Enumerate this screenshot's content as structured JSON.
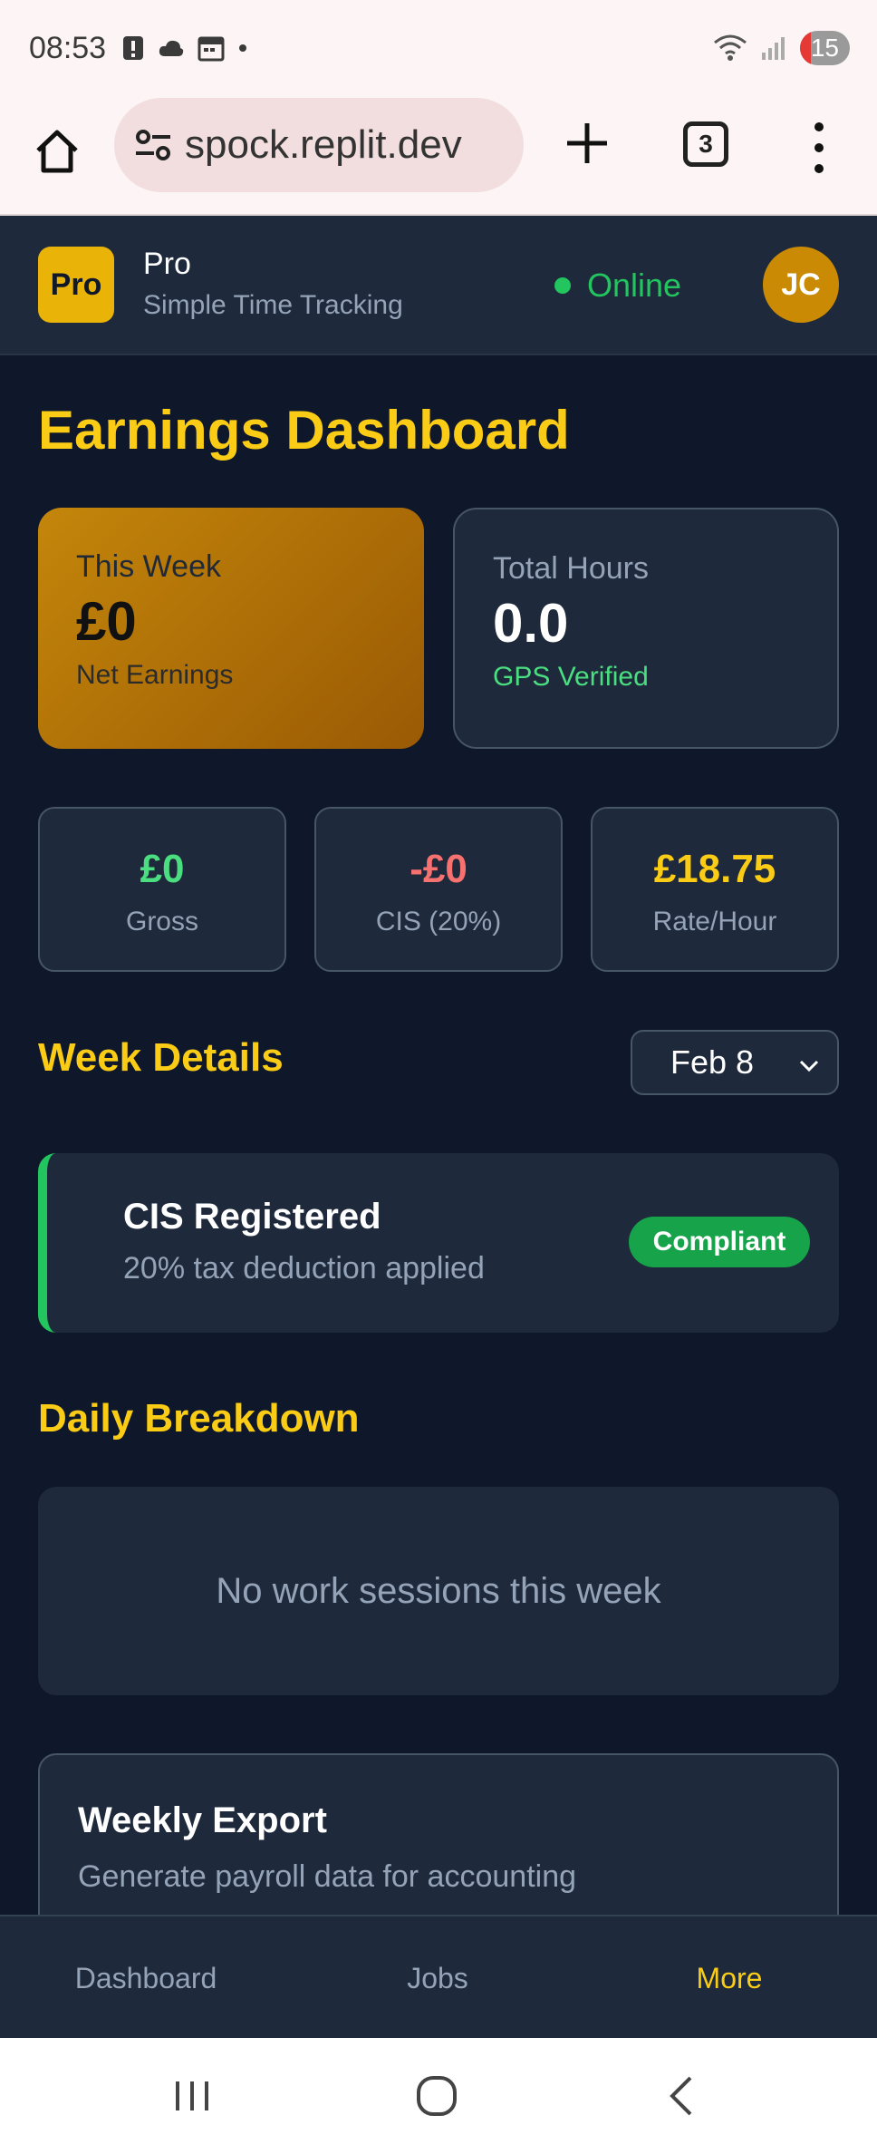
{
  "status_bar": {
    "time": "08:53",
    "battery": "15"
  },
  "browser": {
    "url": "spock.replit.dev",
    "tab_count": "3"
  },
  "header": {
    "logo": "Pro",
    "brand_title": "Pro",
    "brand_subtitle": "Simple Time Tracking",
    "status": "Online",
    "avatar_initials": "JC",
    "status_color": "#22c55e"
  },
  "main": {
    "title": "Earnings Dashboard",
    "this_week": {
      "label": "This Week",
      "value": "£0",
      "sub": "Net Earnings"
    },
    "total_hours": {
      "label": "Total Hours",
      "value": "0.0",
      "sub": "GPS Verified"
    },
    "stats": {
      "gross": {
        "value": "£0",
        "label": "Gross"
      },
      "cis": {
        "value": "-£0",
        "label": "CIS (20%)"
      },
      "rate": {
        "value": "£18.75",
        "label": "Rate/Hour"
      }
    },
    "week_details": {
      "title": "Week Details",
      "selected_week": "Feb 8"
    },
    "cis_card": {
      "title": "CIS Registered",
      "subtitle": "20% tax deduction applied",
      "badge": "Compliant"
    },
    "daily_breakdown": {
      "title": "Daily Breakdown",
      "empty_message": "No work sessions this week"
    },
    "export": {
      "title": "Weekly Export",
      "subtitle": "Generate payroll data for accounting"
    }
  },
  "bottom_nav": {
    "items": [
      "Dashboard",
      "Jobs",
      "More"
    ],
    "active": "More"
  },
  "colors": {
    "accent": "#facc15",
    "background": "#0f172a",
    "card": "#1e293b",
    "positive": "#4ade80",
    "negative": "#f87171"
  },
  "icons": [
    "warning-icon",
    "cloud-icon",
    "calendar-icon",
    "wifi-icon",
    "signal-icon",
    "home-icon",
    "site-settings-icon",
    "plus-icon",
    "more-vert-icon",
    "chevron-down-icon",
    "recents-icon",
    "home-circle-icon",
    "back-icon"
  ]
}
